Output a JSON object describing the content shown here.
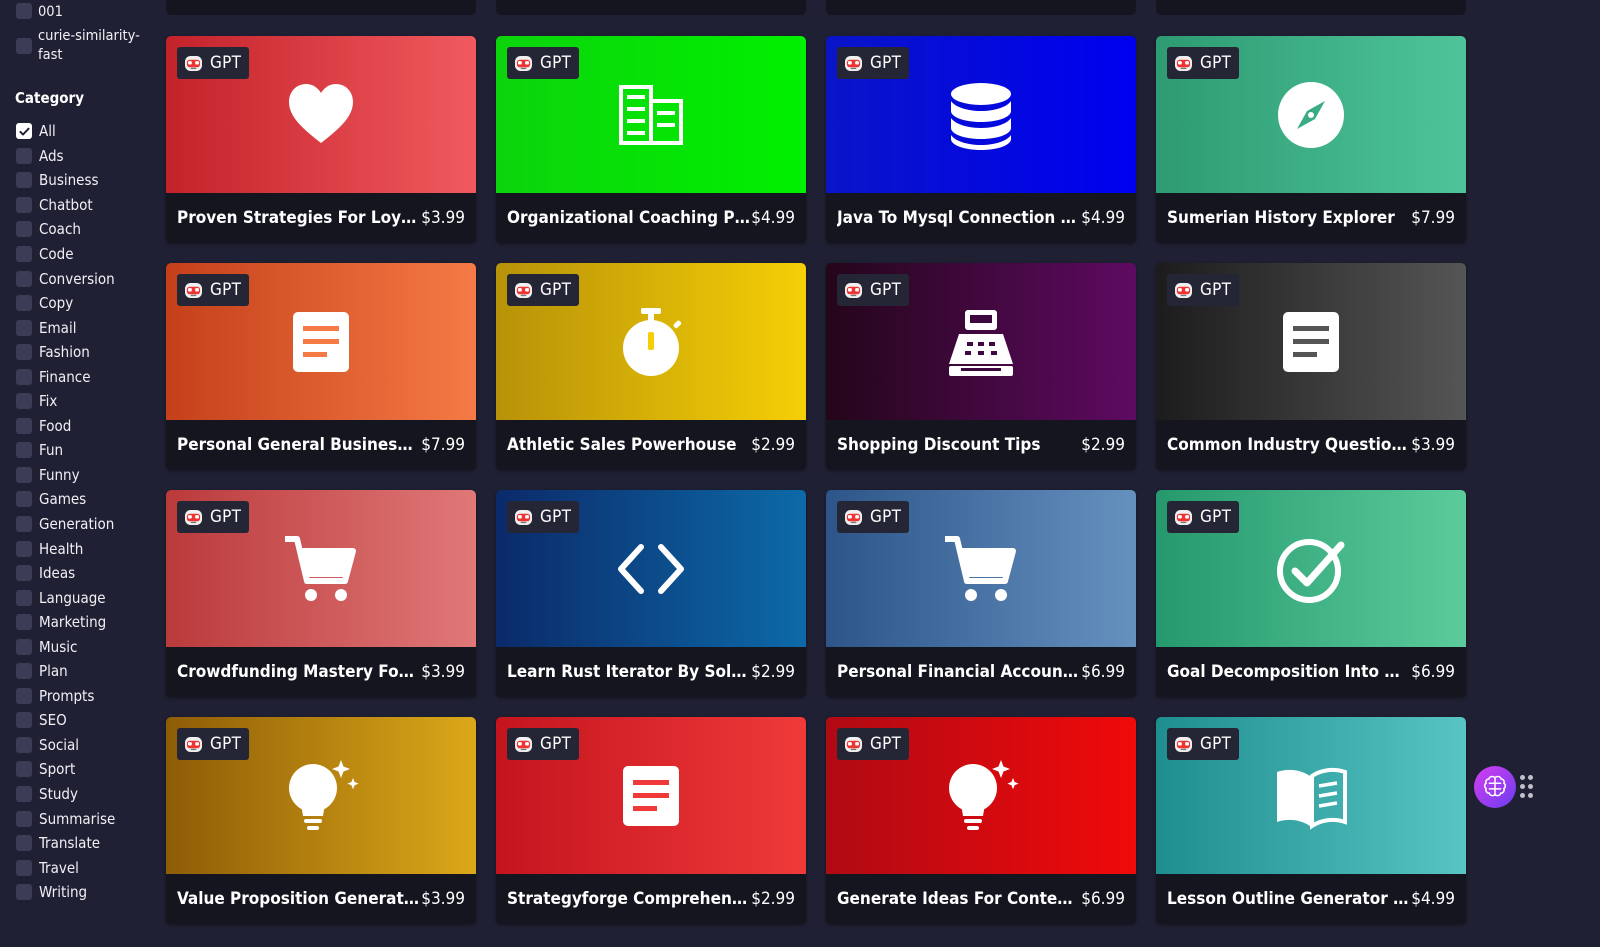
{
  "sidebar": {
    "models": [
      {
        "label": "001",
        "checked": false
      },
      {
        "label": "curie-similarity-fast",
        "checked": false
      }
    ],
    "category_title": "Category",
    "categories": [
      {
        "label": "All",
        "checked": true
      },
      {
        "label": "Ads"
      },
      {
        "label": "Business"
      },
      {
        "label": "Chatbot"
      },
      {
        "label": "Coach"
      },
      {
        "label": "Code"
      },
      {
        "label": "Conversion"
      },
      {
        "label": "Copy"
      },
      {
        "label": "Email"
      },
      {
        "label": "Fashion"
      },
      {
        "label": "Finance"
      },
      {
        "label": "Fix"
      },
      {
        "label": "Food"
      },
      {
        "label": "Fun"
      },
      {
        "label": "Funny"
      },
      {
        "label": "Games"
      },
      {
        "label": "Generation"
      },
      {
        "label": "Health"
      },
      {
        "label": "Ideas"
      },
      {
        "label": "Language"
      },
      {
        "label": "Marketing"
      },
      {
        "label": "Music"
      },
      {
        "label": "Plan"
      },
      {
        "label": "Prompts"
      },
      {
        "label": "SEO"
      },
      {
        "label": "Social"
      },
      {
        "label": "Sport"
      },
      {
        "label": "Study"
      },
      {
        "label": "Summarise"
      },
      {
        "label": "Translate"
      },
      {
        "label": "Travel"
      },
      {
        "label": "Writing"
      }
    ]
  },
  "badge_label": "GPT",
  "cards": [
    {
      "title": "Proven Strategies For Loyalty...",
      "price": "$3.99",
      "icon": "heart-icon",
      "grad": [
        "#c4222a",
        "#f05a5e"
      ]
    },
    {
      "title": "Organizational Coaching Proc...",
      "price": "$4.99",
      "icon": "building-icon",
      "grad": [
        "#0cd40c",
        "#00f000"
      ]
    },
    {
      "title": "Java To Mysql Connection Wit...",
      "price": "$4.99",
      "icon": "database-icon",
      "grad": [
        "#0a14c8",
        "#0000f0"
      ]
    },
    {
      "title": "Sumerian History Explorer",
      "price": "$7.99",
      "icon": "compass-icon",
      "grad": [
        "#2e9b72",
        "#4ec49a"
      ]
    },
    {
      "title": "Personal General Business He...",
      "price": "$7.99",
      "icon": "document-icon",
      "grad": [
        "#c5401a",
        "#f57a45"
      ]
    },
    {
      "title": "Athletic Sales Powerhouse",
      "price": "$2.99",
      "icon": "stopwatch-icon",
      "grad": [
        "#b89208",
        "#f5cf06"
      ]
    },
    {
      "title": "Shopping Discount Tips",
      "price": "$2.99",
      "icon": "cash-register-icon",
      "grad": [
        "#24061a",
        "#5e0a62"
      ]
    },
    {
      "title": "Common Industry Questions ...",
      "price": "$3.99",
      "icon": "document-icon",
      "grad": [
        "#1c1c1c",
        "#555555"
      ]
    },
    {
      "title": "Crowdfunding Mastery Forbes...",
      "price": "$3.99",
      "icon": "cart-icon",
      "grad": [
        "#bb3a3c",
        "#e07878"
      ]
    },
    {
      "title": "Learn Rust Iterator By Solvin...",
      "price": "$2.99",
      "icon": "code-icon",
      "grad": [
        "#0b2a6a",
        "#0d6aa8"
      ]
    },
    {
      "title": "Personal Financial Accountant",
      "price": "$6.99",
      "icon": "cart-icon",
      "grad": [
        "#2d5589",
        "#6591bf"
      ]
    },
    {
      "title": "Goal Decomposition Into Micr...",
      "price": "$6.99",
      "icon": "check-circle-icon",
      "grad": [
        "#25996d",
        "#5ccb9c"
      ]
    },
    {
      "title": "Value Proposition Generator",
      "price": "$3.99",
      "icon": "lightbulb-icon",
      "grad": [
        "#8e5c06",
        "#dca81a"
      ]
    },
    {
      "title": "Strategyforge Comprehensive...",
      "price": "$2.99",
      "icon": "document-icon",
      "grad": [
        "#c4141e",
        "#f03a3a"
      ]
    },
    {
      "title": "Generate Ideas For Content C...",
      "price": "$6.99",
      "icon": "lightbulb-icon",
      "grad": [
        "#b00a14",
        "#f00a0a"
      ]
    },
    {
      "title": "Lesson Outline Generator Wit...",
      "price": "$4.99",
      "icon": "book-icon",
      "grad": [
        "#1f8e8e",
        "#58c4c4"
      ]
    }
  ]
}
